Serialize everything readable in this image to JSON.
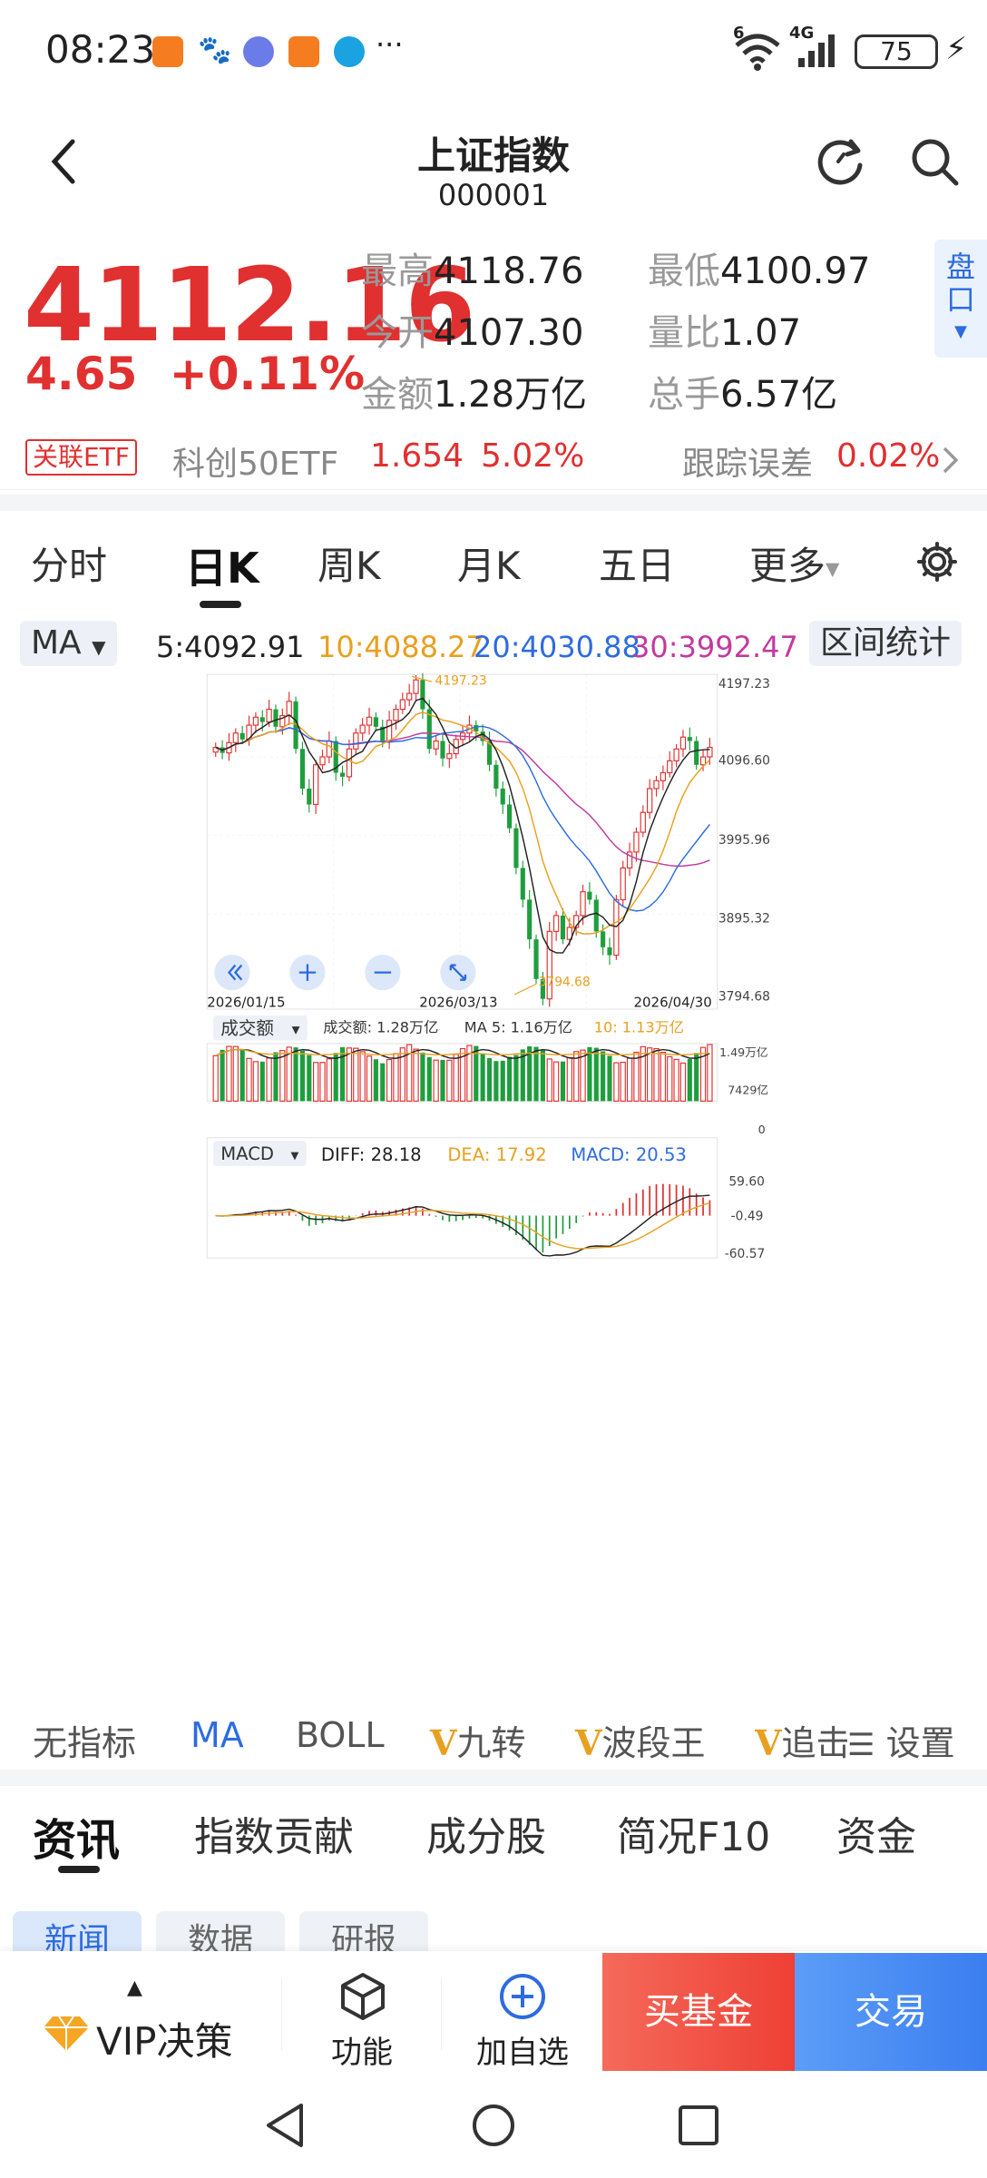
{
  "status_bar": {
    "time": "08:23",
    "battery": "75",
    "signal_4g": "4G",
    "signal_6": "6",
    "more": "···"
  },
  "header": {
    "title": "上证指数",
    "code": "000001"
  },
  "quote": {
    "price": "4112.16",
    "change": "4.65",
    "change_pct": "+0.11%",
    "high_label": "最高",
    "high": "4118.76",
    "low_label": "最低",
    "low": "4100.97",
    "open_label": "今开",
    "open": "4107.30",
    "vol_ratio_label": "量比",
    "vol_ratio": "1.07",
    "amount_label": "金额",
    "amount": "1.28万亿",
    "turnover_label": "总手",
    "turnover": "6.57亿",
    "pankou": "盘口"
  },
  "etf": {
    "tag": "关联ETF",
    "name": "科创50ETF",
    "price": "1.654",
    "pct": "5.02%",
    "tracking_label": "跟踪误差",
    "tracking": "0.02%"
  },
  "period_tabs": [
    "分时",
    "日K",
    "周K",
    "月K",
    "五日",
    "更多"
  ],
  "ma_bar": {
    "dropdown": "MA",
    "ma5": "5:4092.91",
    "ma10": "10:4088.27",
    "ma20": "20:4030.88",
    "ma30": "30:3992.47",
    "range_stats": "区间统计"
  },
  "kchart": {
    "y_labels": [
      "4197.23",
      "4096.60",
      "3995.96",
      "3895.32",
      "3794.68"
    ],
    "x_labels": [
      "2026/01/15",
      "2026/03/13",
      "2026/04/30"
    ],
    "max_label": "4197.23",
    "min_label": "3794.68"
  },
  "volume": {
    "dropdown": "成交额",
    "amount_label": "成交额: 1.28万亿",
    "ma5_label": "MA 5: 1.16万亿",
    "ma10_label": "10: 1.13万亿",
    "y_top": "1.49万亿",
    "y_mid": "7429亿",
    "y_bottom": "0"
  },
  "macd": {
    "dropdown": "MACD",
    "diff": "DIFF: 28.18",
    "dea": "DEA: 17.92",
    "macd": "MACD: 20.53",
    "y_top": "59.60",
    "y_mid": "-0.49",
    "y_bottom": "-60.57"
  },
  "indicator_tabs": [
    "无指标",
    "MA",
    "BOLL",
    "九转",
    "波段王",
    "追击",
    "设置"
  ],
  "news_tabs": [
    "资讯",
    "指数贡献",
    "成分股",
    "简况F10",
    "资金"
  ],
  "sub_tabs": [
    "新闻",
    "数据",
    "研报"
  ],
  "bottom_bar": {
    "vip": "VIP决策",
    "function": "功能",
    "add_watch": "加自选",
    "buy_fund": "买基金",
    "trade": "交易"
  },
  "colors": {
    "up": "#e03030",
    "down": "#1e9e3e",
    "ma5": "#222222",
    "ma10": "#e8a020",
    "ma20": "#2d6cdf",
    "ma30": "#c23aa0",
    "accent": "#2d6cdf"
  }
}
